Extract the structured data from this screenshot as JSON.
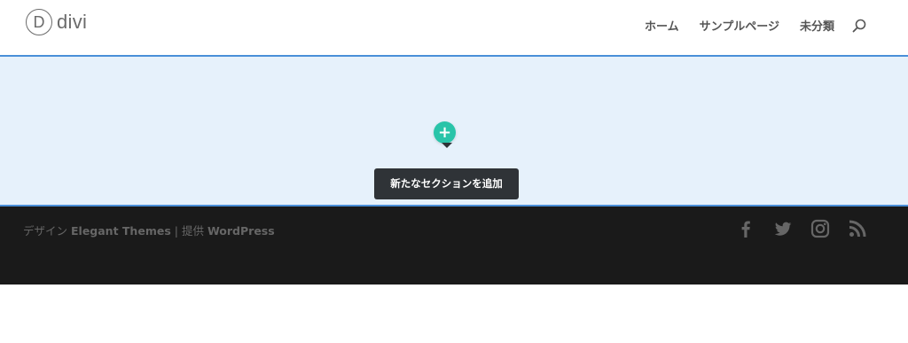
{
  "header": {
    "logo_letter": "D",
    "logo_text": "divi",
    "nav": [
      "ホーム",
      "サンプルページ",
      "未分類"
    ],
    "search_icon": "search-icon"
  },
  "builder": {
    "add_button_label": "+",
    "add_button_color": "#29c4a9",
    "tooltip": "新たなセクションを追加",
    "section_bg": "#e6f1fb",
    "section_border": "#4a8fd8"
  },
  "footer": {
    "credit_prefix": "デザイン",
    "credit_theme": "Elegant Themes",
    "credit_sep": "|",
    "credit_provided": "提供",
    "credit_platform": "WordPress",
    "social_icons": [
      "facebook-icon",
      "twitter-icon",
      "instagram-icon",
      "rss-icon"
    ],
    "bg_color": "#1a1a1a"
  }
}
